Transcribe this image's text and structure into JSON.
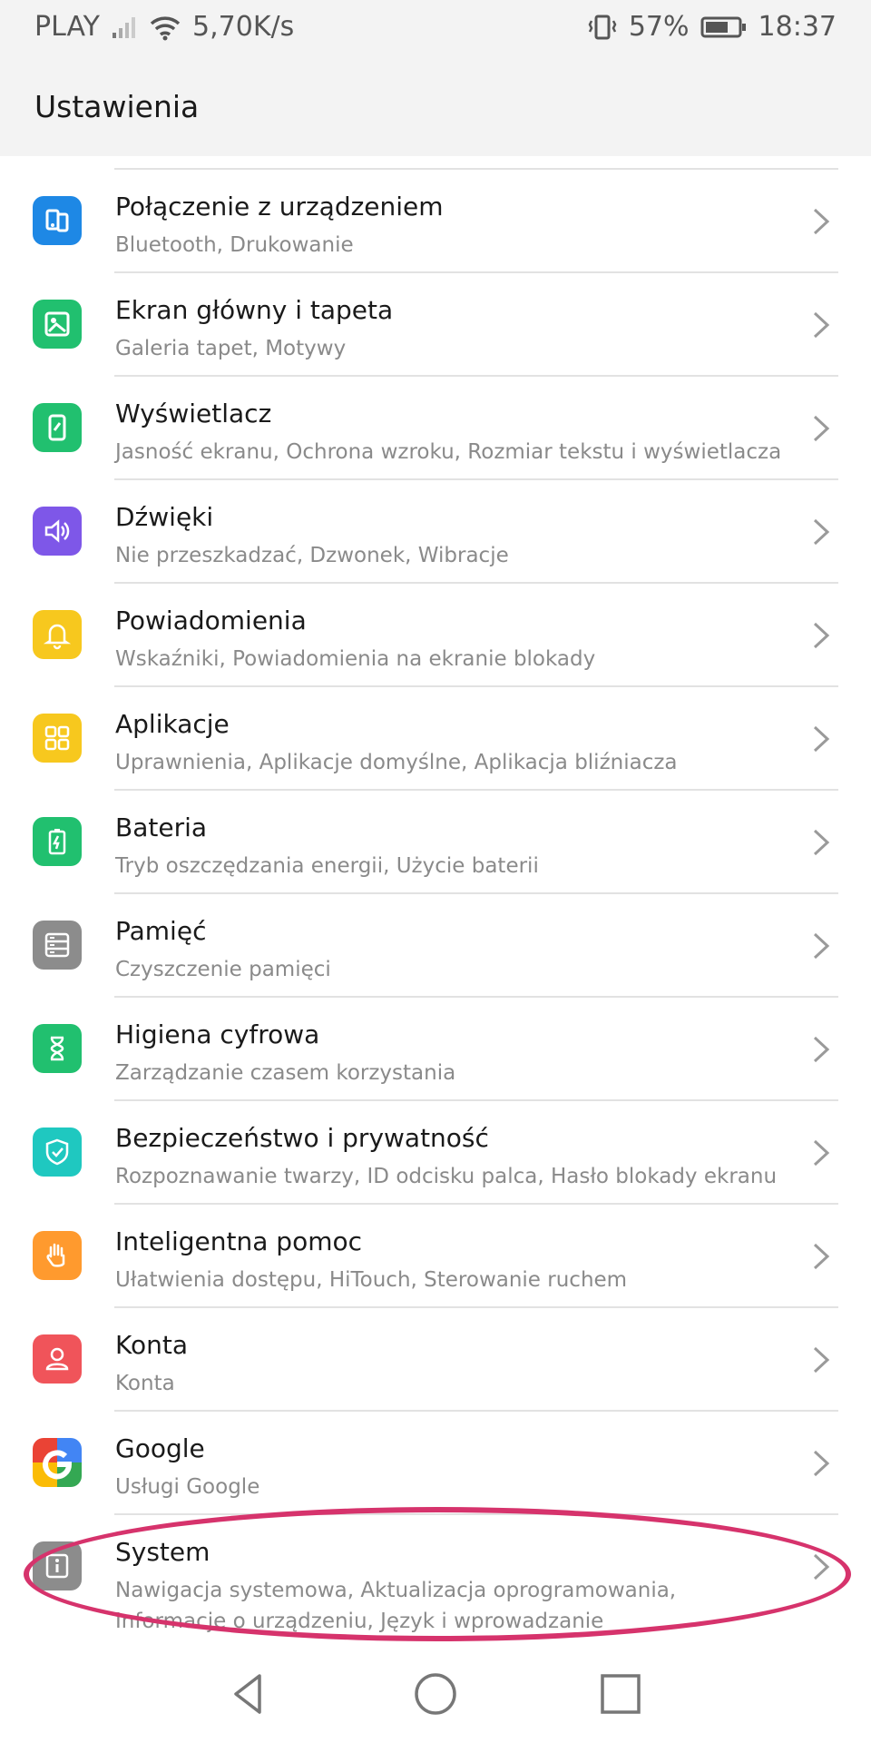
{
  "status_bar": {
    "carrier": "PLAY",
    "speed": "5,70K/s",
    "battery_percent": "57%",
    "time": "18:37"
  },
  "app_bar": {
    "title": "Ustawienia"
  },
  "settings_items": [
    {
      "title": "Połączenie z urządzeniem",
      "subtitle": "Bluetooth, Drukowanie",
      "icon": "device-connection-icon",
      "color": "#1e88e5"
    },
    {
      "title": "Ekran główny i tapeta",
      "subtitle": "Galeria tapet, Motywy",
      "icon": "wallpaper-icon",
      "color": "#21c06f"
    },
    {
      "title": "Wyświetlacz",
      "subtitle": "Jasność ekranu, Ochrona wzroku, Rozmiar tekstu i wyświetlacza",
      "icon": "display-icon",
      "color": "#21c06f"
    },
    {
      "title": "Dźwięki",
      "subtitle": "Nie przeszkadzać, Dzwonek, Wibracje",
      "icon": "sound-icon",
      "color": "#7e57e8"
    },
    {
      "title": "Powiadomienia",
      "subtitle": "Wskaźniki, Powiadomienia na ekranie blokady",
      "icon": "bell-icon",
      "color": "#f7c81e"
    },
    {
      "title": "Aplikacje",
      "subtitle": "Uprawnienia, Aplikacje domyślne, Aplikacja bliźniacza",
      "icon": "apps-grid-icon",
      "color": "#f7c81e"
    },
    {
      "title": "Bateria",
      "subtitle": "Tryb oszczędzania energii, Użycie baterii",
      "icon": "battery-icon",
      "color": "#21c06f"
    },
    {
      "title": "Pamięć",
      "subtitle": "Czyszczenie pamięci",
      "icon": "storage-icon",
      "color": "#8c8c8c"
    },
    {
      "title": "Higiena cyfrowa",
      "subtitle": "Zarządzanie czasem korzystania",
      "icon": "hourglass-icon",
      "color": "#21c06f"
    },
    {
      "title": "Bezpieczeństwo i prywatność",
      "subtitle": "Rozpoznawanie twarzy, ID odcisku palca, Hasło blokady ekranu",
      "icon": "shield-icon",
      "color": "#1fc8c0"
    },
    {
      "title": "Inteligentna pomoc",
      "subtitle": "Ułatwienia dostępu, HiTouch, Sterowanie ruchem",
      "icon": "hand-icon",
      "color": "#ff9a2e"
    },
    {
      "title": "Konta",
      "subtitle": "Konta",
      "icon": "account-icon",
      "color": "#f0545a"
    },
    {
      "title": "Google",
      "subtitle": "Usługi Google",
      "icon": "google-icon",
      "color": "#ffffff"
    },
    {
      "title": "System",
      "subtitle": "Nawigacja systemowa, Aktualizacja oprogramowania, Informacje o urządzeniu, Język i wprowadzanie",
      "icon": "info-icon",
      "color": "#8c8c8c"
    }
  ],
  "nav_bar": {
    "back": "back-icon",
    "home": "home-icon",
    "recents": "recents-icon"
  },
  "highlight_color": "#d6336c"
}
